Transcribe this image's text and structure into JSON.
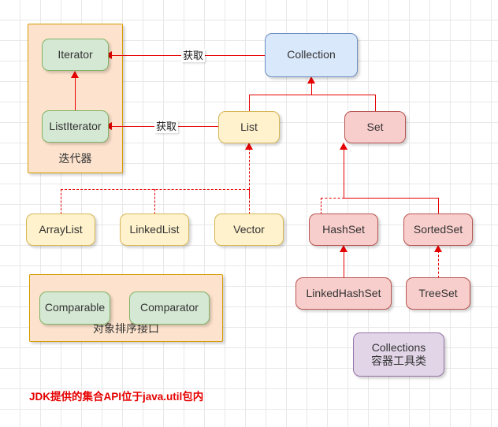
{
  "diagram": {
    "title": "Java Collection API hierarchy",
    "footnote": "JDK提供的集合API位于java.util包内",
    "colors": {
      "green_fill": "#d5e8d4",
      "green_stroke": "#82b366",
      "yellow_fill": "#fff2cc",
      "yellow_stroke": "#d6b656",
      "pink_fill": "#f8cecc",
      "pink_stroke": "#b85450",
      "blue_fill": "#dae8fc",
      "blue_stroke": "#6c8ebf",
      "purple_fill": "#e1d5e7",
      "purple_stroke": "#9673a6",
      "group_fill": "#fde3cd",
      "group_stroke": "#d79b00",
      "edge": "#e60000",
      "grid": "#e8e8e8"
    }
  },
  "groups": {
    "iterator_group": {
      "label": "迭代器"
    },
    "sorting_group": {
      "label": "对象排序接口"
    }
  },
  "nodes": {
    "iterator": "Iterator",
    "list_iterator": "ListIterator",
    "collection": "Collection",
    "list": "List",
    "set": "Set",
    "array_list": "ArrayList",
    "linked_list": "LinkedList",
    "vector": "Vector",
    "hash_set": "HashSet",
    "sorted_set": "SortedSet",
    "linked_hash_set": "LinkedHashSet",
    "tree_set": "TreeSet",
    "comparable": "Comparable",
    "comparator": "Comparator",
    "collections": "Collections\n容器工具类"
  },
  "edge_labels": {
    "collection_to_iterator": "获取",
    "list_to_listiterator": "获取"
  }
}
